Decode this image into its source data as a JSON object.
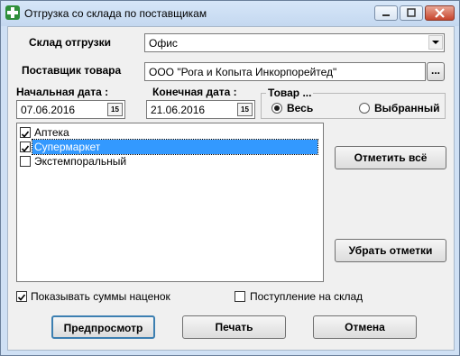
{
  "window": {
    "title": "Отгрузка со склада по поставщикам"
  },
  "warehouse": {
    "label": "Склад отгрузки",
    "value": "Офис"
  },
  "supplier": {
    "label": "Поставщик товара",
    "value": "ООО \"Рога и Копыта Инкорпорейтед\"",
    "browse_label": "..."
  },
  "start_date": {
    "label": "Начальная дата :",
    "value": "07.06.2016"
  },
  "end_date": {
    "label": "Конечная дата :",
    "value": "21.06.2016"
  },
  "calendar_icon_text": "15",
  "goods": {
    "legend": "Товар ...",
    "all_label": "Весь",
    "selected_label": "Выбранный",
    "selected": "all"
  },
  "list": {
    "items": [
      {
        "label": "Аптека",
        "checked": true,
        "highlighted": false
      },
      {
        "label": "Супермаркет",
        "checked": true,
        "highlighted": true
      },
      {
        "label": "Экстемпоральный",
        "checked": false,
        "highlighted": false
      }
    ]
  },
  "buttons": {
    "check_all": "Отметить всё",
    "uncheck_all": "Убрать отметки",
    "preview": "Предпросмотр",
    "print": "Печать",
    "cancel": "Отмена"
  },
  "options": {
    "show_markup_label": "Показывать суммы наценок",
    "show_markup_checked": true,
    "warehouse_receipt_label": "Поступление на склад",
    "warehouse_receipt_checked": false
  }
}
